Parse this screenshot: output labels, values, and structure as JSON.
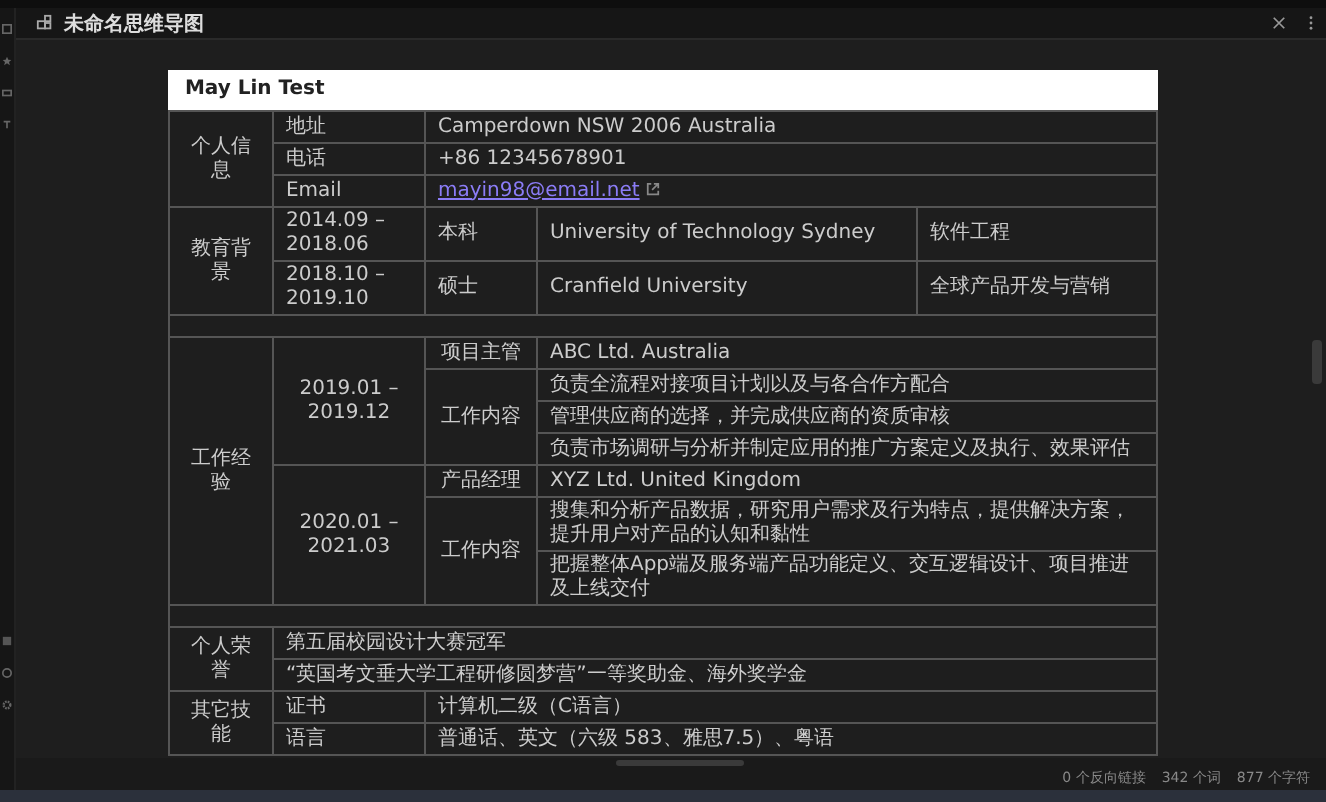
{
  "tab": {
    "title": "未命名思维导图"
  },
  "document": {
    "title": "May Lin Test",
    "sections": [
      {
        "kind": "fields",
        "heading": "个人信息",
        "rows": [
          {
            "label": "地址",
            "value": "Camperdown NSW 2006 Australia"
          },
          {
            "label": "电话",
            "value": "+86 12345678901"
          },
          {
            "label": "Email",
            "link": "mayin98@email.net"
          }
        ]
      },
      {
        "kind": "education",
        "heading": "教育背景",
        "rows": [
          {
            "period": "2014.09 – 2018.06",
            "degree": "本科",
            "school": "University of Technology Sydney",
            "major": "软件工程"
          },
          {
            "period": "2018.10 – 2019.10",
            "degree": "硕士",
            "school": "Cranfield University",
            "major": "全球产品开发与营销"
          }
        ]
      },
      {
        "kind": "spacer"
      },
      {
        "kind": "work",
        "heading": "工作经验",
        "jobs": [
          {
            "period": "2019.01 – 2019.12",
            "role_label": "项目主管",
            "company": "ABC Ltd. Australia",
            "duties_label": "工作内容",
            "duties": [
              "负责全流程对接项目计划以及与各合作方配合",
              "管理供应商的选择，并完成供应商的资质审核",
              "负责市场调研与分析并制定应用的推广方案定义及执行、效果评估"
            ]
          },
          {
            "period": "2020.01 – 2021.03",
            "role_label": "产品经理",
            "company": "XYZ Ltd. United Kingdom",
            "duties_label": "工作内容",
            "duties": [
              "搜集和分析产品数据，研究用户需求及行为特点，提供解决方案，提升用户对产品的认知和黏性",
              "把握整体App端及服务端产品功能定义、交互逻辑设计、项目推进及上线交付"
            ]
          }
        ]
      },
      {
        "kind": "spacer"
      },
      {
        "kind": "list",
        "heading": "个人荣誉",
        "items": [
          "第五届校园设计大赛冠军",
          "“英国考文垂大学工程研修圆梦营”一等奖助金、海外奖学金"
        ]
      },
      {
        "kind": "fields",
        "heading": "其它技能",
        "rows": [
          {
            "label": "证书",
            "value": "计算机二级（C语言）"
          },
          {
            "label": "语言",
            "value": "普通话、英文（六级 583、雅思7.5）、粤语"
          }
        ]
      }
    ]
  },
  "status_bar": {
    "backlinks": "0 个反向链接",
    "words": "342 个词",
    "characters": "877 个字符"
  }
}
